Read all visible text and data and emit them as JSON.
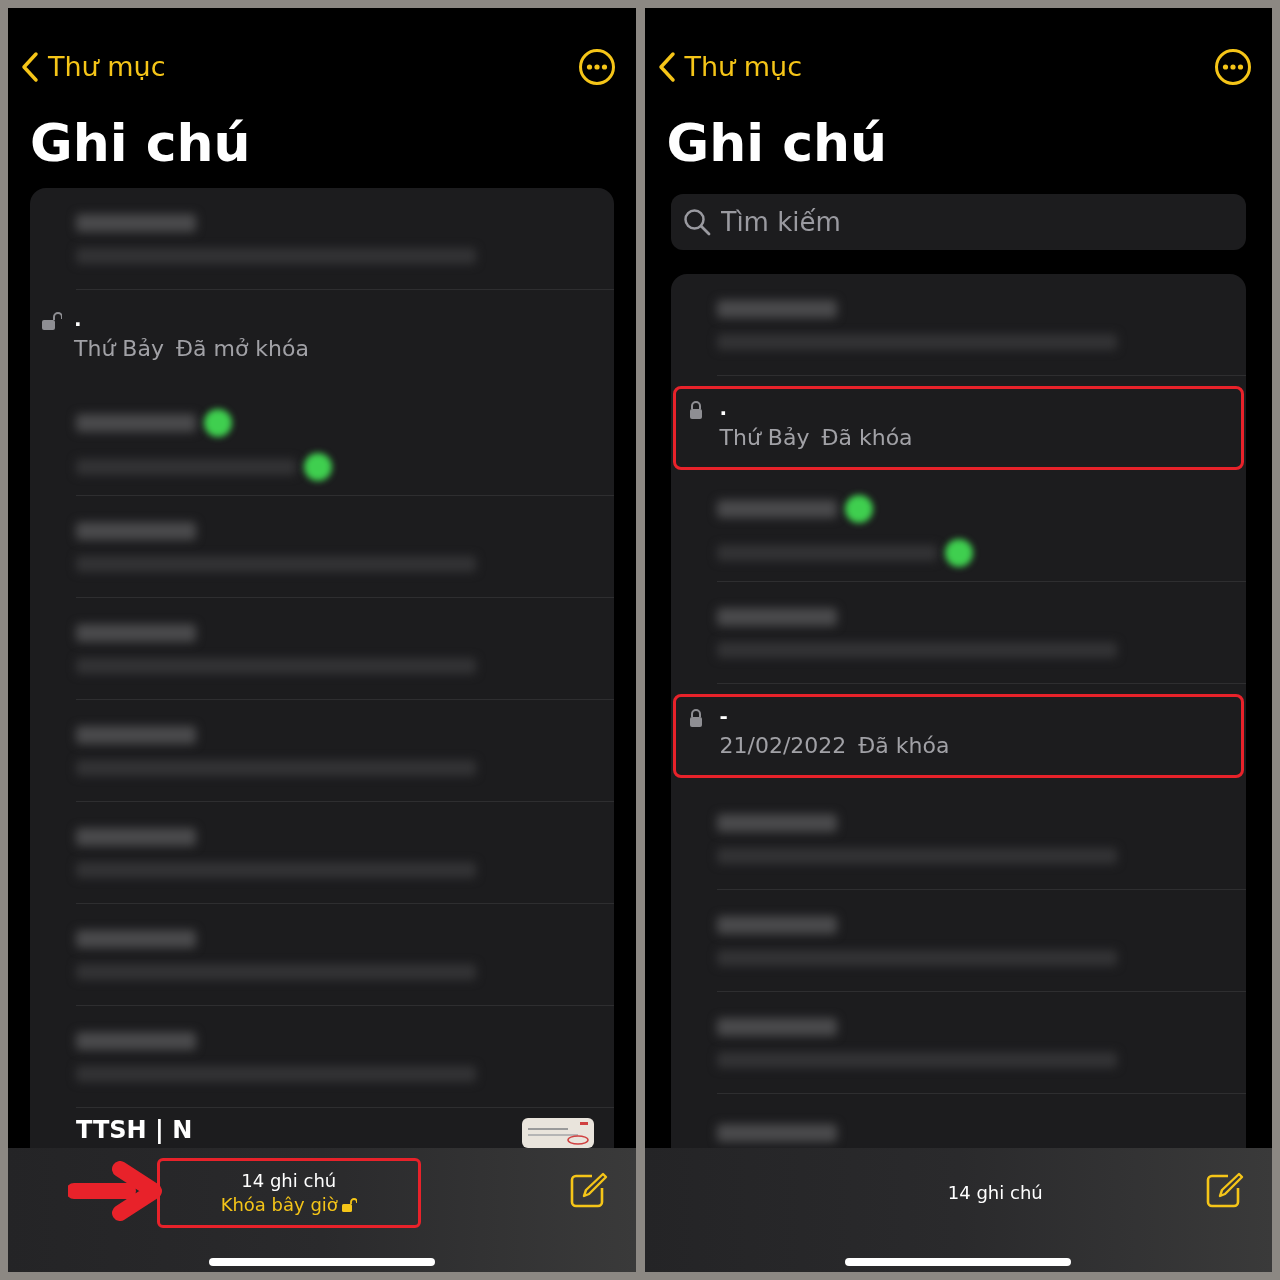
{
  "panels": [
    {
      "back_label": "Thư mục",
      "title": "Ghi chú",
      "notes": [
        {
          "kind": "blurred"
        },
        {
          "kind": "note",
          "title": ".",
          "date": "Thứ Bảy",
          "status": "Đã mở khóa",
          "locked": false,
          "highlighted": false
        },
        {
          "kind": "blurred_dot"
        },
        {
          "kind": "blurred"
        },
        {
          "kind": "blurred"
        },
        {
          "kind": "blurred"
        },
        {
          "kind": "blurred"
        },
        {
          "kind": "blurred"
        },
        {
          "kind": "blurred"
        },
        {
          "kind": "partial",
          "title": "TTSH | N"
        }
      ],
      "footer": {
        "count": "14 ghi chú",
        "action": "Khóa bây giờ",
        "highlighted": true,
        "arrow": true
      }
    },
    {
      "back_label": "Thư mục",
      "title": "Ghi chú",
      "search": {
        "placeholder": "Tìm kiếm"
      },
      "notes": [
        {
          "kind": "blurred"
        },
        {
          "kind": "note",
          "title": ".",
          "date": "Thứ Bảy",
          "status": "Đã khóa",
          "locked": true,
          "highlighted": true
        },
        {
          "kind": "blurred_dot"
        },
        {
          "kind": "blurred"
        },
        {
          "kind": "note",
          "title": "-",
          "date": "21/02/2022",
          "status": "Đã khóa",
          "locked": true,
          "highlighted": true
        },
        {
          "kind": "blurred"
        },
        {
          "kind": "blurred"
        },
        {
          "kind": "blurred"
        },
        {
          "kind": "blurred_cut"
        }
      ],
      "footer": {
        "count": "14 ghi chú",
        "highlighted": false,
        "arrow": false
      }
    }
  ]
}
